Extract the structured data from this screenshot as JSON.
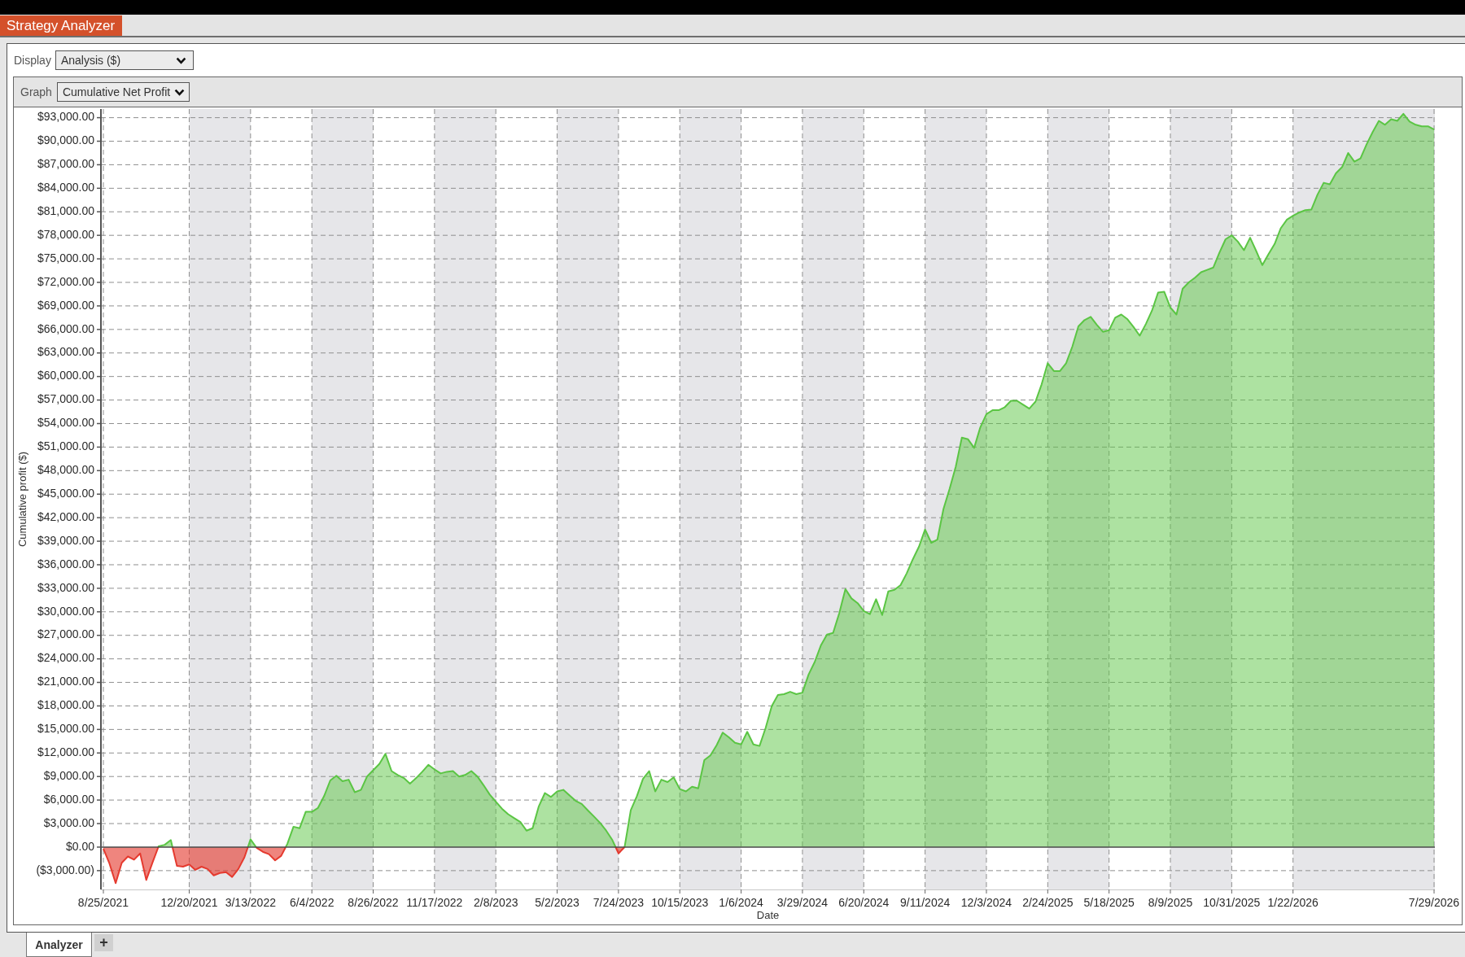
{
  "window": {
    "title": "Strategy Analyzer"
  },
  "display": {
    "label": "Display",
    "value": "Analysis ($)"
  },
  "graph": {
    "label": "Graph",
    "value": "Cumulative Net Profit",
    "chart_data": {
      "type": "area",
      "xlabel": "Date",
      "ylabel": "Cumulative profit ($)",
      "grid": true,
      "categories": [
        "8/25/2021",
        null,
        null,
        null,
        null,
        null,
        null,
        null,
        null,
        null,
        null,
        null,
        null,
        null,
        "12/20/2021",
        null,
        null,
        null,
        null,
        null,
        null,
        null,
        null,
        null,
        "3/13/2022",
        null,
        null,
        null,
        null,
        null,
        null,
        null,
        null,
        null,
        "6/4/2022",
        null,
        null,
        null,
        null,
        null,
        null,
        null,
        null,
        null,
        "8/26/2022",
        null,
        null,
        null,
        null,
        null,
        null,
        null,
        null,
        null,
        "11/17/2022",
        null,
        null,
        null,
        null,
        null,
        null,
        null,
        null,
        null,
        "2/8/2023",
        null,
        null,
        null,
        null,
        null,
        null,
        null,
        null,
        null,
        "5/2/2023",
        null,
        null,
        null,
        null,
        null,
        null,
        null,
        null,
        null,
        "7/24/2023",
        null,
        null,
        null,
        null,
        null,
        null,
        null,
        null,
        null,
        "10/15/2023",
        null,
        null,
        null,
        null,
        null,
        null,
        null,
        null,
        null,
        "1/6/2024",
        null,
        null,
        null,
        null,
        null,
        null,
        null,
        null,
        null,
        "3/29/2024",
        null,
        null,
        null,
        null,
        null,
        null,
        null,
        null,
        null,
        "6/20/2024",
        null,
        null,
        null,
        null,
        null,
        null,
        null,
        null,
        null,
        "9/11/2024",
        null,
        null,
        null,
        null,
        null,
        null,
        null,
        null,
        null,
        "12/3/2024",
        null,
        null,
        null,
        null,
        null,
        null,
        null,
        null,
        null,
        "2/24/2025",
        null,
        null,
        null,
        null,
        null,
        null,
        null,
        null,
        null,
        "5/18/2025",
        null,
        null,
        null,
        null,
        null,
        null,
        null,
        null,
        null,
        "8/9/2025",
        null,
        null,
        null,
        null,
        null,
        null,
        null,
        null,
        null,
        "10/31/2025",
        null,
        null,
        null,
        null,
        null,
        null,
        null,
        null,
        null,
        "1/22/2026",
        null,
        null,
        null,
        null,
        null,
        null,
        null,
        null,
        null,
        null,
        null,
        null,
        null,
        null,
        null,
        null,
        null,
        null,
        null,
        null,
        null,
        null,
        "7/29/2026"
      ],
      "series": [
        {
          "color": "#5bc544",
          "values": [
            null,
            null,
            null,
            null,
            null,
            null,
            null,
            null,
            null,
            100,
            300,
            900,
            null,
            null,
            null,
            null,
            null,
            null,
            null,
            null,
            null,
            null,
            null,
            null,
            1000,
            null,
            null,
            null,
            null,
            null,
            400,
            2600,
            2400,
            4500,
            4500,
            5000,
            6500,
            8500,
            9100,
            8400,
            8600,
            7000,
            7300,
            9000,
            9800,
            10600,
            11900,
            9700,
            9200,
            8800,
            8100,
            8800,
            9600,
            10500,
            9900,
            9400,
            9600,
            9700,
            9000,
            9200,
            9700,
            9000,
            7900,
            6700,
            5800,
            4900,
            4200,
            3700,
            3200,
            2100,
            2400,
            5200,
            6900,
            6400,
            7100,
            7300,
            6600,
            5900,
            5500,
            4700,
            3900,
            3100,
            2100,
            900,
            null,
            0,
            4700,
            6500,
            8700,
            9700,
            7100,
            8600,
            8300,
            8900,
            7400,
            7100,
            7700,
            7500,
            11100,
            11700,
            13000,
            14600,
            14000,
            13300,
            13100,
            14700,
            13100,
            12900,
            15200,
            18000,
            19400,
            19500,
            19800,
            19500,
            19700,
            22000,
            23600,
            25700,
            27100,
            27300,
            29800,
            32900,
            31700,
            31100,
            30100,
            29700,
            31600,
            29600,
            32600,
            32800,
            33400,
            34900,
            36700,
            38300,
            40500,
            38800,
            39200,
            43100,
            45700,
            48500,
            52200,
            52000,
            50900,
            53500,
            55200,
            55700,
            55700,
            56100,
            56900,
            56900,
            56400,
            55900,
            56800,
            59000,
            61700,
            60700,
            60700,
            61700,
            63800,
            66400,
            67200,
            67600,
            66600,
            65700,
            65900,
            67500,
            67900,
            67300,
            66300,
            65200,
            66700,
            68400,
            70700,
            70800,
            68800,
            67900,
            71200,
            72000,
            72600,
            73300,
            73600,
            73900,
            75800,
            77500,
            78000,
            77200,
            76100,
            77700,
            76000,
            74200,
            75600,
            76900,
            78900,
            80000,
            80500,
            80900,
            81200,
            81300,
            83200,
            84700,
            84500,
            85900,
            86700,
            88500,
            87400,
            87800,
            89600,
            91200,
            92600,
            92100,
            92800,
            92600,
            93500,
            92500,
            92100,
            91900,
            91900,
            91500
          ]
        },
        {
          "color": "#e53a2f",
          "values": [
            -200,
            -2100,
            -4600,
            -2000,
            -1200,
            -1600,
            -800,
            -4200,
            -2000,
            null,
            null,
            null,
            -2400,
            -2500,
            -2200,
            -2900,
            -2500,
            -2800,
            -3600,
            -3300,
            -3200,
            -3800,
            -2800,
            -1300,
            null,
            -100,
            -600,
            -900,
            -1700,
            -1100,
            null,
            null,
            null,
            null,
            null,
            null,
            null,
            null,
            null,
            null,
            null,
            null,
            null,
            null,
            null,
            null,
            null,
            null,
            null,
            null,
            null,
            null,
            null,
            null,
            null,
            null,
            null,
            null,
            null,
            null,
            null,
            null,
            null,
            null,
            null,
            null,
            null,
            null,
            null,
            null,
            null,
            null,
            null,
            null,
            null,
            null,
            null,
            null,
            null,
            null,
            null,
            null,
            null,
            null,
            -800,
            0,
            null,
            null,
            null,
            null,
            null,
            null,
            null,
            null,
            null,
            null,
            null,
            null,
            null,
            null,
            null,
            null,
            null,
            null,
            null,
            null,
            null,
            null,
            null,
            null,
            null,
            null,
            null,
            null,
            null,
            null,
            null,
            null,
            null,
            null,
            null,
            null,
            null,
            null,
            null,
            null,
            null,
            null,
            null,
            null,
            null,
            null,
            null,
            null,
            null,
            null,
            null,
            null,
            null,
            null,
            null,
            null,
            null,
            null,
            null,
            null,
            null,
            null,
            null,
            null,
            null,
            null,
            null,
            null,
            null,
            null,
            null,
            null,
            null,
            null,
            null,
            null,
            null,
            null,
            null,
            null,
            null,
            null,
            null,
            null,
            null,
            null,
            null,
            null,
            null,
            null,
            null,
            null,
            null,
            null,
            null,
            null,
            null,
            null,
            null,
            null,
            null,
            null,
            null,
            null,
            null,
            null,
            null,
            null,
            null,
            null,
            null,
            null,
            null,
            null,
            null,
            null,
            null,
            null,
            null,
            null,
            null,
            null,
            null,
            null,
            null,
            null,
            null,
            null,
            null,
            null,
            null,
            null
          ]
        }
      ],
      "ylim": [
        -5400,
        94100
      ],
      "yticks": [
        {
          "value": -3000,
          "label": "($3,000.00)"
        },
        {
          "value": 0,
          "label": "$0.00"
        },
        {
          "value": 3000,
          "label": "$3,000.00"
        },
        {
          "value": 6000,
          "label": "$6,000.00"
        },
        {
          "value": 9000,
          "label": "$9,000.00"
        },
        {
          "value": 12000,
          "label": "$12,000.00"
        },
        {
          "value": 15000,
          "label": "$15,000.00"
        },
        {
          "value": 18000,
          "label": "$18,000.00"
        },
        {
          "value": 21000,
          "label": "$21,000.00"
        },
        {
          "value": 24000,
          "label": "$24,000.00"
        },
        {
          "value": 27000,
          "label": "$27,000.00"
        },
        {
          "value": 30000,
          "label": "$30,000.00"
        },
        {
          "value": 33000,
          "label": "$33,000.00"
        },
        {
          "value": 36000,
          "label": "$36,000.00"
        },
        {
          "value": 39000,
          "label": "$39,000.00"
        },
        {
          "value": 42000,
          "label": "$42,000.00"
        },
        {
          "value": 45000,
          "label": "$45,000.00"
        },
        {
          "value": 48000,
          "label": "$48,000.00"
        },
        {
          "value": 51000,
          "label": "$51,000.00"
        },
        {
          "value": 54000,
          "label": "$54,000.00"
        },
        {
          "value": 57000,
          "label": "$57,000.00"
        },
        {
          "value": 60000,
          "label": "$60,000.00"
        },
        {
          "value": 63000,
          "label": "$63,000.00"
        },
        {
          "value": 66000,
          "label": "$66,000.00"
        },
        {
          "value": 69000,
          "label": "$69,000.00"
        },
        {
          "value": 72000,
          "label": "$72,000.00"
        },
        {
          "value": 75000,
          "label": "$75,000.00"
        },
        {
          "value": 78000,
          "label": "$78,000.00"
        },
        {
          "value": 81000,
          "label": "$81,000.00"
        },
        {
          "value": 84000,
          "label": "$84,000.00"
        },
        {
          "value": 87000,
          "label": "$87,000.00"
        },
        {
          "value": 90000,
          "label": "$90,000.00"
        },
        {
          "value": 93000,
          "label": "$93,000.00"
        }
      ]
    }
  },
  "bottom_tabs": [
    {
      "label": "Analyzer",
      "selected": true
    }
  ],
  "add_tab": {
    "label": "+"
  }
}
